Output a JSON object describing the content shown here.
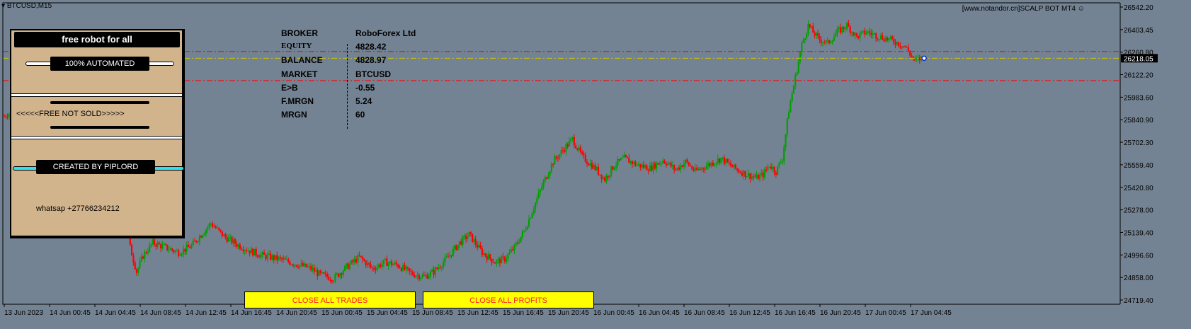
{
  "symbol": "BTCUSD,M15",
  "header_right": "[www.notandor.cn]SCALP BOT MT4",
  "panel": {
    "title": "free robot for all",
    "automated": "100% AUTOMATED",
    "free_not_sold": "<<<<<FREE NOT SOLD>>>>>",
    "created_by": "CREATED BY PIPLORD",
    "whatsapp": "whatsap +27766234212"
  },
  "account": [
    {
      "label": "BROKER",
      "value": "RoboForex Ltd"
    },
    {
      "label": "EQUITY",
      "value": "4828.42"
    },
    {
      "label": "BALANCE",
      "value": "4828.97"
    },
    {
      "label": "MARKET",
      "value": "BTCUSD"
    },
    {
      "label": "E>B",
      "value": "-0.55"
    },
    {
      "label": "F.MRGN",
      "value": "5.24"
    },
    {
      "label": "MRGN",
      "value": "60"
    }
  ],
  "buttons": {
    "close_trades": "CLOSE ALL TRADES",
    "close_profits": "CLOSE ALL PROFITS"
  },
  "price_axis": [
    "26542.20",
    "26403.45",
    "26260.80",
    "26122.20",
    "25983.60",
    "25840.90",
    "25702.30",
    "25559.40",
    "25420.80",
    "25278.00",
    "25139.40",
    "24996.60",
    "24858.00",
    "24719.40"
  ],
  "current_price": "26218.05",
  "time_axis": [
    "13 Jun 2023",
    "14 Jun 00:45",
    "14 Jun 04:45",
    "14 Jun 08:45",
    "14 Jun 12:45",
    "14 Jun 16:45",
    "14 Jun 20:45",
    "15 Jun 00:45",
    "15 Jun 04:45",
    "15 Jun 08:45",
    "15 Jun 12:45",
    "15 Jun 16:45",
    "15 Jun 20:45",
    "16 Jun 00:45",
    "16 Jun 04:45",
    "16 Jun 08:45",
    "16 Jun 12:45",
    "16 Jun 16:45",
    "16 Jun 20:45",
    "17 Jun 00:45",
    "17 Jun 04:45"
  ],
  "colors": {
    "background": "#748393",
    "bull": "#00a000",
    "bear": "#ff0000",
    "level_red": "#ff0000",
    "level_yellow": "#c8c800"
  },
  "chart_data": {
    "type": "candlestick",
    "y_range": [
      24700,
      26560
    ],
    "levels": [
      26260,
      26218,
      26080
    ],
    "close_path": [
      [
        0,
        25860
      ],
      [
        6,
        25900
      ],
      [
        12,
        25960
      ],
      [
        18,
        25990
      ],
      [
        24,
        26010
      ],
      [
        30,
        25980
      ],
      [
        36,
        26000
      ],
      [
        42,
        26030
      ],
      [
        48,
        26010
      ],
      [
        54,
        26020
      ],
      [
        60,
        25990
      ],
      [
        66,
        25900
      ],
      [
        70,
        25830
      ],
      [
        74,
        25400
      ],
      [
        78,
        25050
      ],
      [
        82,
        24900
      ],
      [
        86,
        25000
      ],
      [
        92,
        25080
      ],
      [
        100,
        25050
      ],
      [
        108,
        25020
      ],
      [
        116,
        25060
      ],
      [
        122,
        25130
      ],
      [
        128,
        25200
      ],
      [
        136,
        25120
      ],
      [
        144,
        25070
      ],
      [
        152,
        25030
      ],
      [
        160,
        25000
      ],
      [
        170,
        24980
      ],
      [
        180,
        24950
      ],
      [
        190,
        24920
      ],
      [
        196,
        24880
      ],
      [
        204,
        24860
      ],
      [
        212,
        24930
      ],
      [
        220,
        24990
      ],
      [
        228,
        24920
      ],
      [
        236,
        24960
      ],
      [
        244,
        24940
      ],
      [
        252,
        24890
      ],
      [
        260,
        24870
      ],
      [
        266,
        24900
      ],
      [
        274,
        24980
      ],
      [
        282,
        25080
      ],
      [
        288,
        25130
      ],
      [
        296,
        25020
      ],
      [
        304,
        24960
      ],
      [
        310,
        24980
      ],
      [
        316,
        25050
      ],
      [
        322,
        25150
      ],
      [
        328,
        25300
      ],
      [
        334,
        25450
      ],
      [
        340,
        25580
      ],
      [
        346,
        25650
      ],
      [
        352,
        25720
      ],
      [
        358,
        25610
      ],
      [
        366,
        25540
      ],
      [
        372,
        25470
      ],
      [
        378,
        25560
      ],
      [
        384,
        25600
      ],
      [
        392,
        25560
      ],
      [
        400,
        25540
      ],
      [
        408,
        25590
      ],
      [
        416,
        25530
      ],
      [
        422,
        25580
      ],
      [
        428,
        25520
      ],
      [
        436,
        25560
      ],
      [
        444,
        25600
      ],
      [
        452,
        25540
      ],
      [
        460,
        25500
      ],
      [
        466,
        25480
      ],
      [
        470,
        25500
      ],
      [
        474,
        25560
      ],
      [
        478,
        25520
      ],
      [
        482,
        25600
      ],
      [
        486,
        25900
      ],
      [
        490,
        26100
      ],
      [
        494,
        26300
      ],
      [
        498,
        26420
      ],
      [
        504,
        26340
      ],
      [
        510,
        26310
      ],
      [
        516,
        26380
      ],
      [
        522,
        26420
      ],
      [
        528,
        26350
      ],
      [
        534,
        26380
      ],
      [
        540,
        26360
      ],
      [
        546,
        26340
      ],
      [
        552,
        26320
      ],
      [
        558,
        26290
      ],
      [
        564,
        26200
      ],
      [
        568,
        26218
      ]
    ]
  }
}
